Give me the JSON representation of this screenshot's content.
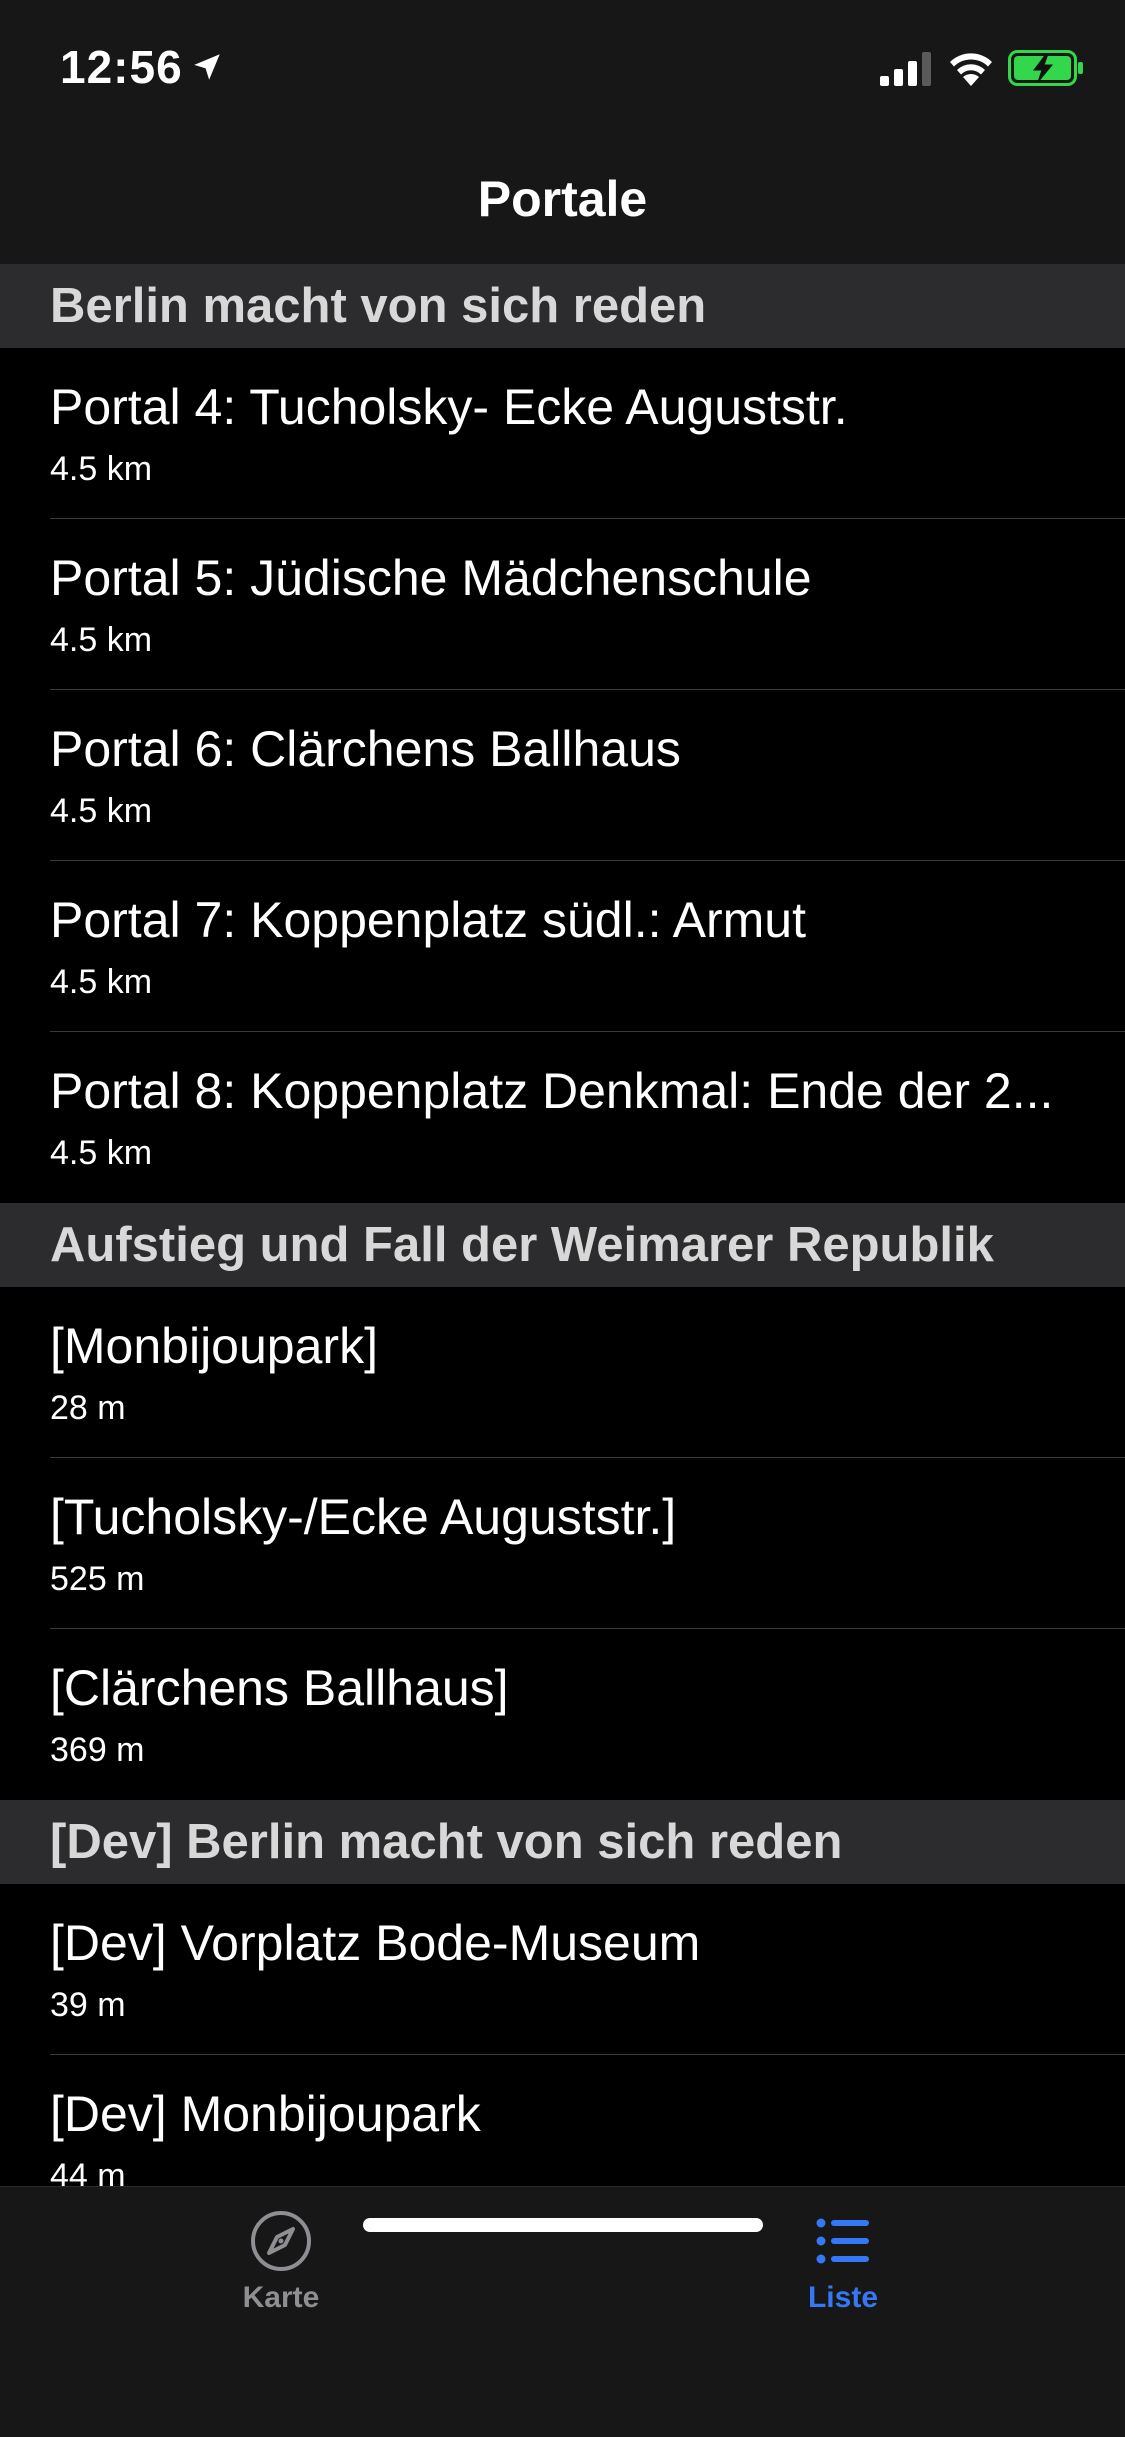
{
  "status_bar": {
    "time": "12:56",
    "icons": [
      "location-arrow-icon",
      "cellular-signal-icon",
      "wifi-icon",
      "battery-charging-icon"
    ],
    "battery_color": "#32d74b"
  },
  "nav": {
    "title": "Portale"
  },
  "sections": [
    {
      "header": "Berlin macht von sich reden",
      "rows": [
        {
          "title": "Portal 4: Tucholsky- Ecke Auguststr.",
          "distance": "4.5 km"
        },
        {
          "title": "Portal 5: Jüdische Mädchenschule",
          "distance": "4.5 km"
        },
        {
          "title": "Portal 6: Clärchens Ballhaus",
          "distance": "4.5 km"
        },
        {
          "title": "Portal 7: Koppenplatz südl.: Armut",
          "distance": "4.5 km"
        },
        {
          "title": "Portal 8: Koppenplatz Denkmal: Ende der 2...",
          "distance": "4.5 km"
        }
      ]
    },
    {
      "header": "Aufstieg und Fall der Weimarer Republik",
      "rows": [
        {
          "title": "[Monbijoupark]",
          "distance": "28 m"
        },
        {
          "title": "[Tucholsky-/Ecke Auguststr.]",
          "distance": "525 m"
        },
        {
          "title": "[Clärchens Ballhaus]",
          "distance": "369 m"
        }
      ]
    },
    {
      "header": "[Dev] Berlin macht von sich reden",
      "rows": [
        {
          "title": "[Dev] Vorplatz Bode-Museum",
          "distance": "39 m"
        },
        {
          "title": "[Dev] Monbijoupark",
          "distance": "44 m"
        }
      ]
    }
  ],
  "tab_bar": {
    "tabs": [
      {
        "label": "Karte",
        "icon": "compass-icon",
        "selected": false
      },
      {
        "label": "Liste",
        "icon": "list-icon",
        "selected": true
      }
    ],
    "active_color": "#3478f6",
    "inactive_color": "#8e8e93"
  }
}
